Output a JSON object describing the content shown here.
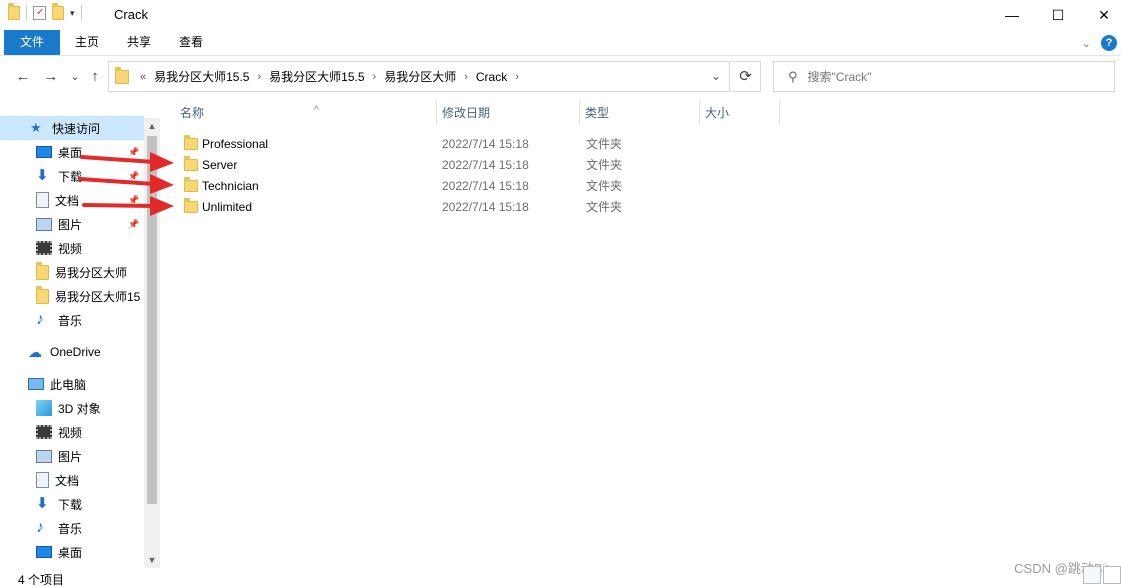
{
  "window": {
    "title": "Crack",
    "controls": {
      "minimize": "—",
      "maximize": "☐",
      "close": "✕"
    }
  },
  "ribbon": {
    "tabs": [
      "文件",
      "主页",
      "共享",
      "查看"
    ],
    "help": "?"
  },
  "nav": {
    "back": "←",
    "forward": "→",
    "recent": "⌄",
    "up": "↑",
    "breadcrumb_prefix": "«",
    "breadcrumb": [
      "易我分区大师15.5",
      "易我分区大师15.5",
      "易我分区大师",
      "Crack"
    ],
    "search_placeholder": "搜索\"Crack\""
  },
  "sidebar": {
    "quick_access": "快速访问",
    "quick_items": [
      {
        "label": "桌面",
        "icon": "desktop-icon",
        "pinned": true
      },
      {
        "label": "下载",
        "icon": "download-icon",
        "pinned": true
      },
      {
        "label": "文档",
        "icon": "document-icon",
        "pinned": true
      },
      {
        "label": "图片",
        "icon": "picture-icon",
        "pinned": true
      },
      {
        "label": "视频",
        "icon": "video-icon",
        "pinned": false
      },
      {
        "label": "易我分区大师",
        "icon": "folder-icon",
        "pinned": false
      },
      {
        "label": "易我分区大师15",
        "icon": "folder-icon",
        "pinned": false
      },
      {
        "label": "音乐",
        "icon": "music-icon",
        "pinned": false
      }
    ],
    "onedrive": "OneDrive",
    "this_pc": "此电脑",
    "pc_items": [
      {
        "label": "3D 对象",
        "icon": "3d-objects-icon"
      },
      {
        "label": "视频",
        "icon": "video-icon"
      },
      {
        "label": "图片",
        "icon": "picture-icon"
      },
      {
        "label": "文档",
        "icon": "document-icon"
      },
      {
        "label": "下载",
        "icon": "download-icon"
      },
      {
        "label": "音乐",
        "icon": "music-icon"
      },
      {
        "label": "桌面",
        "icon": "desktop-icon"
      }
    ]
  },
  "columns": {
    "name": "名称",
    "date": "修改日期",
    "type": "类型",
    "size": "大小"
  },
  "files": [
    {
      "name": "Professional",
      "date": "2022/7/14 15:18",
      "type": "文件夹",
      "highlighted": false
    },
    {
      "name": "Server",
      "date": "2022/7/14 15:18",
      "type": "文件夹",
      "highlighted": true
    },
    {
      "name": "Technician",
      "date": "2022/7/14 15:18",
      "type": "文件夹",
      "highlighted": true
    },
    {
      "name": "Unlimited",
      "date": "2022/7/14 15:18",
      "type": "文件夹",
      "highlighted": true
    }
  ],
  "status": {
    "count": "4 个项目"
  },
  "watermark": "CSDN @跳动Bit",
  "colors": {
    "accent": "#1979ca",
    "arrow": "#e32a2a",
    "selected": "#cce8ff"
  }
}
